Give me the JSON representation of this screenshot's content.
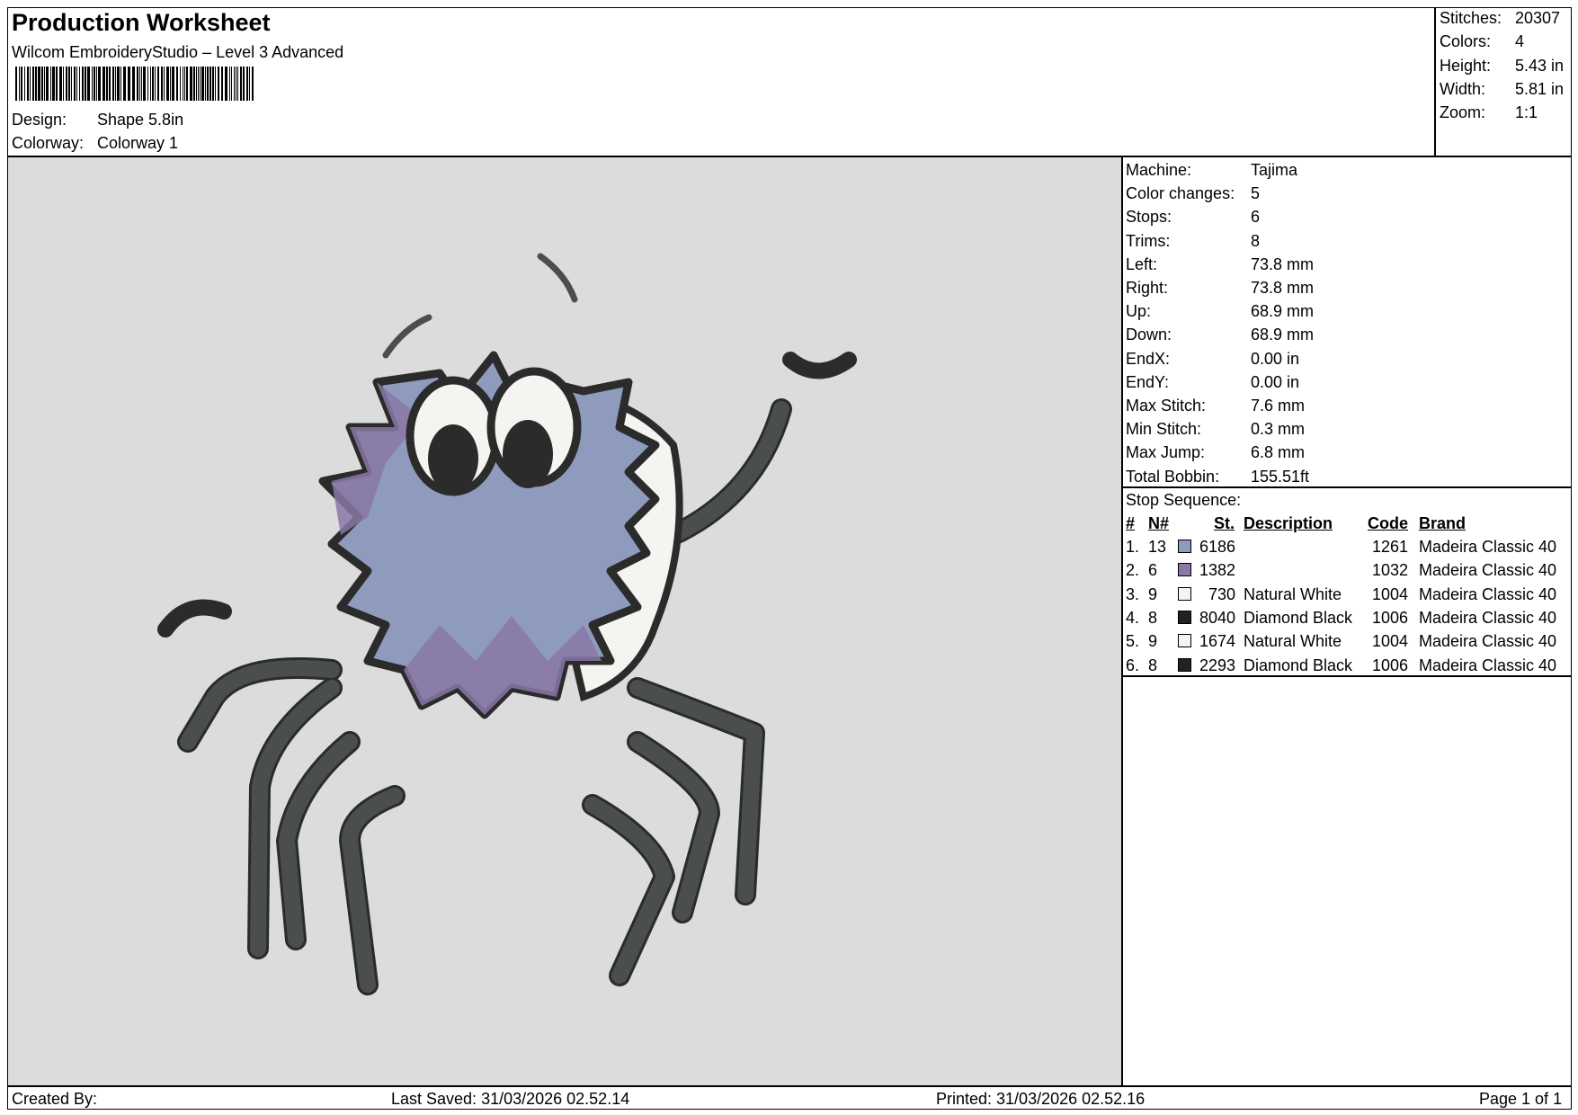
{
  "header": {
    "title": "Production Worksheet",
    "software": "Wilcom EmbroideryStudio – Level 3 Advanced",
    "design_label": "Design:",
    "design_value": "Shape 5.8in",
    "colorway_label": "Colorway:",
    "colorway_value": "Colorway 1"
  },
  "summary": {
    "stitches_label": "Stitches:",
    "stitches_value": "20307",
    "colors_label": "Colors:",
    "colors_value": "4",
    "height_label": "Height:",
    "height_value": "5.43 in",
    "width_label": "Width:",
    "width_value": "5.81 in",
    "zoom_label": "Zoom:",
    "zoom_value": "1:1"
  },
  "machine_info": [
    {
      "label": "Machine:",
      "value": "Tajima"
    },
    {
      "label": "Color changes:",
      "value": "5"
    },
    {
      "label": "Stops:",
      "value": "6"
    },
    {
      "label": "Trims:",
      "value": "8"
    },
    {
      "label": "Left:",
      "value": "73.8 mm"
    },
    {
      "label": "Right:",
      "value": "73.8 mm"
    },
    {
      "label": "Up:",
      "value": "68.9 mm"
    },
    {
      "label": "Down:",
      "value": "68.9 mm"
    },
    {
      "label": "EndX:",
      "value": "0.00 in"
    },
    {
      "label": "EndY:",
      "value": "0.00 in"
    },
    {
      "label": "Max Stitch:",
      "value": "7.6 mm"
    },
    {
      "label": "Min Stitch:",
      "value": "0.3 mm"
    },
    {
      "label": "Max Jump:",
      "value": "6.8 mm"
    },
    {
      "label": "Total Bobbin:",
      "value": "155.51ft"
    }
  ],
  "stop_sequence": {
    "title": "Stop Sequence:",
    "columns": {
      "num": "#",
      "n": "N#",
      "st": "St.",
      "description": "Description",
      "code": "Code",
      "brand": "Brand"
    },
    "rows": [
      {
        "num": "1.",
        "n": "13",
        "color": "#8e9bbd",
        "st": "6186",
        "description": "",
        "code": "1261",
        "brand": "Madeira Classic 40"
      },
      {
        "num": "2.",
        "n": "6",
        "color": "#8a78a6",
        "st": "1382",
        "description": "",
        "code": "1032",
        "brand": "Madeira Classic 40"
      },
      {
        "num": "3.",
        "n": "9",
        "color": "#f4f4f0",
        "st": "730",
        "description": "Natural White",
        "code": "1004",
        "brand": "Madeira Classic 40"
      },
      {
        "num": "4.",
        "n": "8",
        "color": "#222222",
        "st": "8040",
        "description": "Diamond Black",
        "code": "1006",
        "brand": "Madeira Classic 40"
      },
      {
        "num": "5.",
        "n": "9",
        "color": "#f4f4f0",
        "st": "1674",
        "description": "Natural White",
        "code": "1004",
        "brand": "Madeira Classic 40"
      },
      {
        "num": "6.",
        "n": "8",
        "color": "#222222",
        "st": "2293",
        "description": "Diamond Black",
        "code": "1006",
        "brand": "Madeira Classic 40"
      }
    ]
  },
  "footer": {
    "created_by": "Created By:",
    "last_saved": "Last Saved: 31/03/2026 02.52.14",
    "printed": "Printed: 31/03/2026 02.52.16",
    "page": "Page 1 of 1"
  },
  "colors": {
    "canvas_bg": "#dcdcdc",
    "body_blue": "#8e9bbd",
    "body_purple": "#8a78a6",
    "white": "#f4f4f0",
    "outline": "#2b2b2b",
    "legs": "#4a4f4c"
  }
}
